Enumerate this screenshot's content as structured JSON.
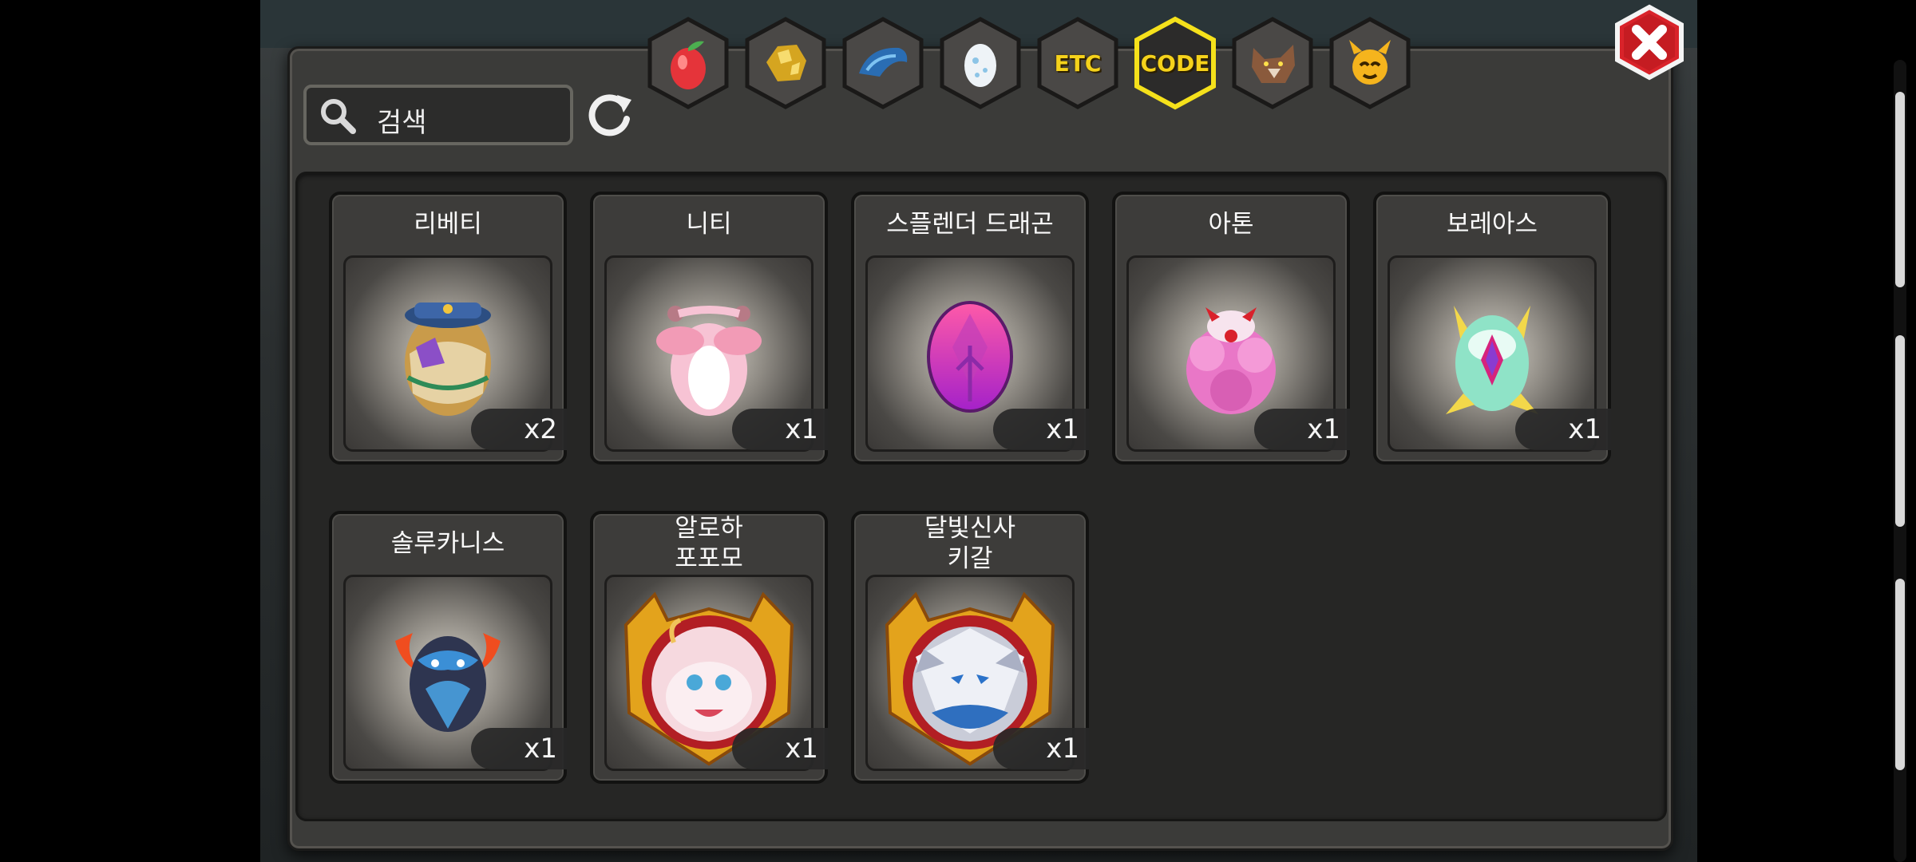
{
  "search": {
    "label": "검색"
  },
  "tabs": [
    {
      "id": "fruit",
      "icon": "fruit-icon",
      "text": "",
      "active": false
    },
    {
      "id": "gold",
      "icon": "gold-ore-icon",
      "text": "",
      "active": false
    },
    {
      "id": "scale",
      "icon": "blue-claw-icon",
      "text": "",
      "active": false
    },
    {
      "id": "egg",
      "icon": "egg-icon",
      "text": "",
      "active": false
    },
    {
      "id": "etc",
      "icon": "etc-icon",
      "text": "ETC",
      "active": false
    },
    {
      "id": "code",
      "icon": "code-icon",
      "text": "CODE",
      "active": true
    },
    {
      "id": "beast",
      "icon": "werewolf-icon",
      "text": "",
      "active": false
    },
    {
      "id": "demon",
      "icon": "horned-face-icon",
      "text": "",
      "active": false
    }
  ],
  "items": [
    {
      "name": "리베티",
      "qty": "x2",
      "icon": "bag-egg-icon"
    },
    {
      "name": "니티",
      "qty": "x1",
      "icon": "pink-dragon-egg-icon"
    },
    {
      "name": "스플렌더 드래곤",
      "qty": "x1",
      "icon": "magenta-egg-icon"
    },
    {
      "name": "아톤",
      "qty": "x1",
      "icon": "fluffy-pink-egg-icon"
    },
    {
      "name": "보레아스",
      "qty": "x1",
      "icon": "winged-crystal-egg-icon"
    },
    {
      "name": "솔루카니스",
      "qty": "x1",
      "icon": "flame-dark-egg-icon"
    },
    {
      "name": "알로하\n포포모",
      "qty": "x1",
      "icon": "pink-dragon-portrait-icon"
    },
    {
      "name": "달빛신사\n키갈",
      "qty": "x1",
      "icon": "wolf-portrait-icon"
    }
  ],
  "colors": {
    "accent": "#f5d21b",
    "close": "#d9232a",
    "panel": "#3b3b39"
  }
}
